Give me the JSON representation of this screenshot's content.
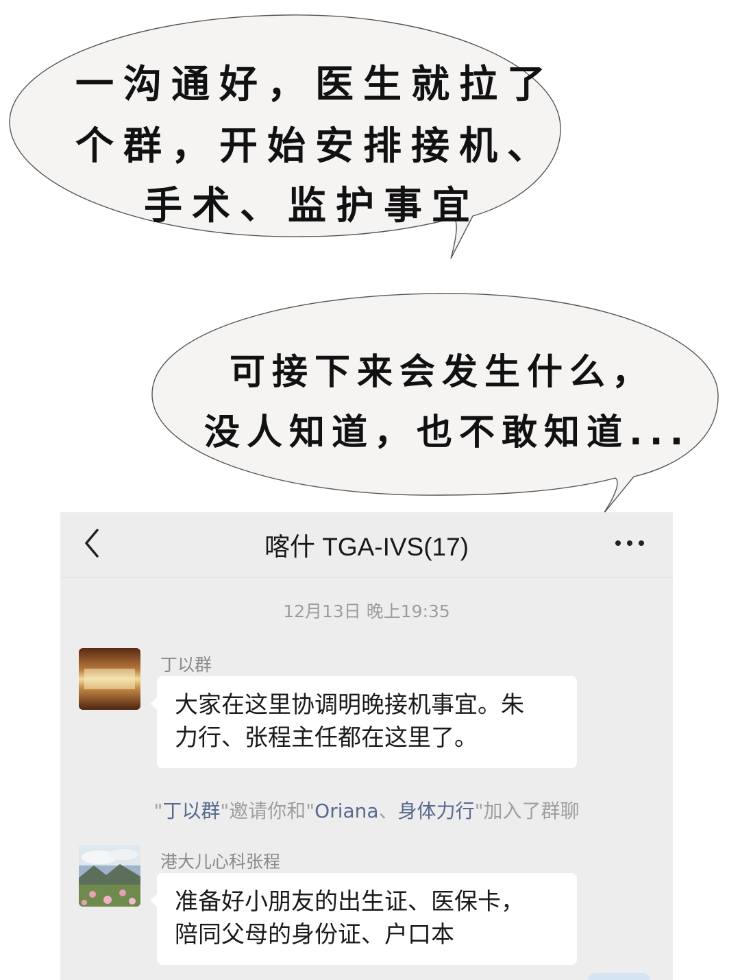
{
  "bubble_top": {
    "lines": [
      "一沟通好，医生就拉了",
      "个群，开始安排接机、",
      "手术、监护事宜"
    ]
  },
  "bubble_bottom": {
    "lines": [
      "可接下来会发生什么，",
      "没人知道，也不敢知道..."
    ]
  },
  "chat": {
    "title": "喀什 TGA-IVS(17)",
    "timestamp": "12月13日 晚上19:35",
    "messages": [
      {
        "sender": "丁以群",
        "lines": [
          "大家在这里协调明晚接机事宜。朱",
          "力行、张程主任都在这里了。"
        ]
      },
      {
        "sender": "港大儿心科张程",
        "lines": [
          "准备好小朋友的出生证、医保卡，",
          "陪同父母的身份证、户口本"
        ]
      }
    ],
    "system_notice": {
      "q1": "\"",
      "inviter": "丁以群",
      "q2": "\"邀请你和\"",
      "invitee1": "Oriana",
      "sep": "、",
      "invitee2": "身体力行",
      "tail": "\"加入了群聊"
    }
  },
  "colors": {
    "chat_bg": "#ededed",
    "link": "#57698f",
    "bubble_fill": "#f5f4f2"
  },
  "icons": [
    "back-arrow-icon",
    "more-dots-icon"
  ]
}
